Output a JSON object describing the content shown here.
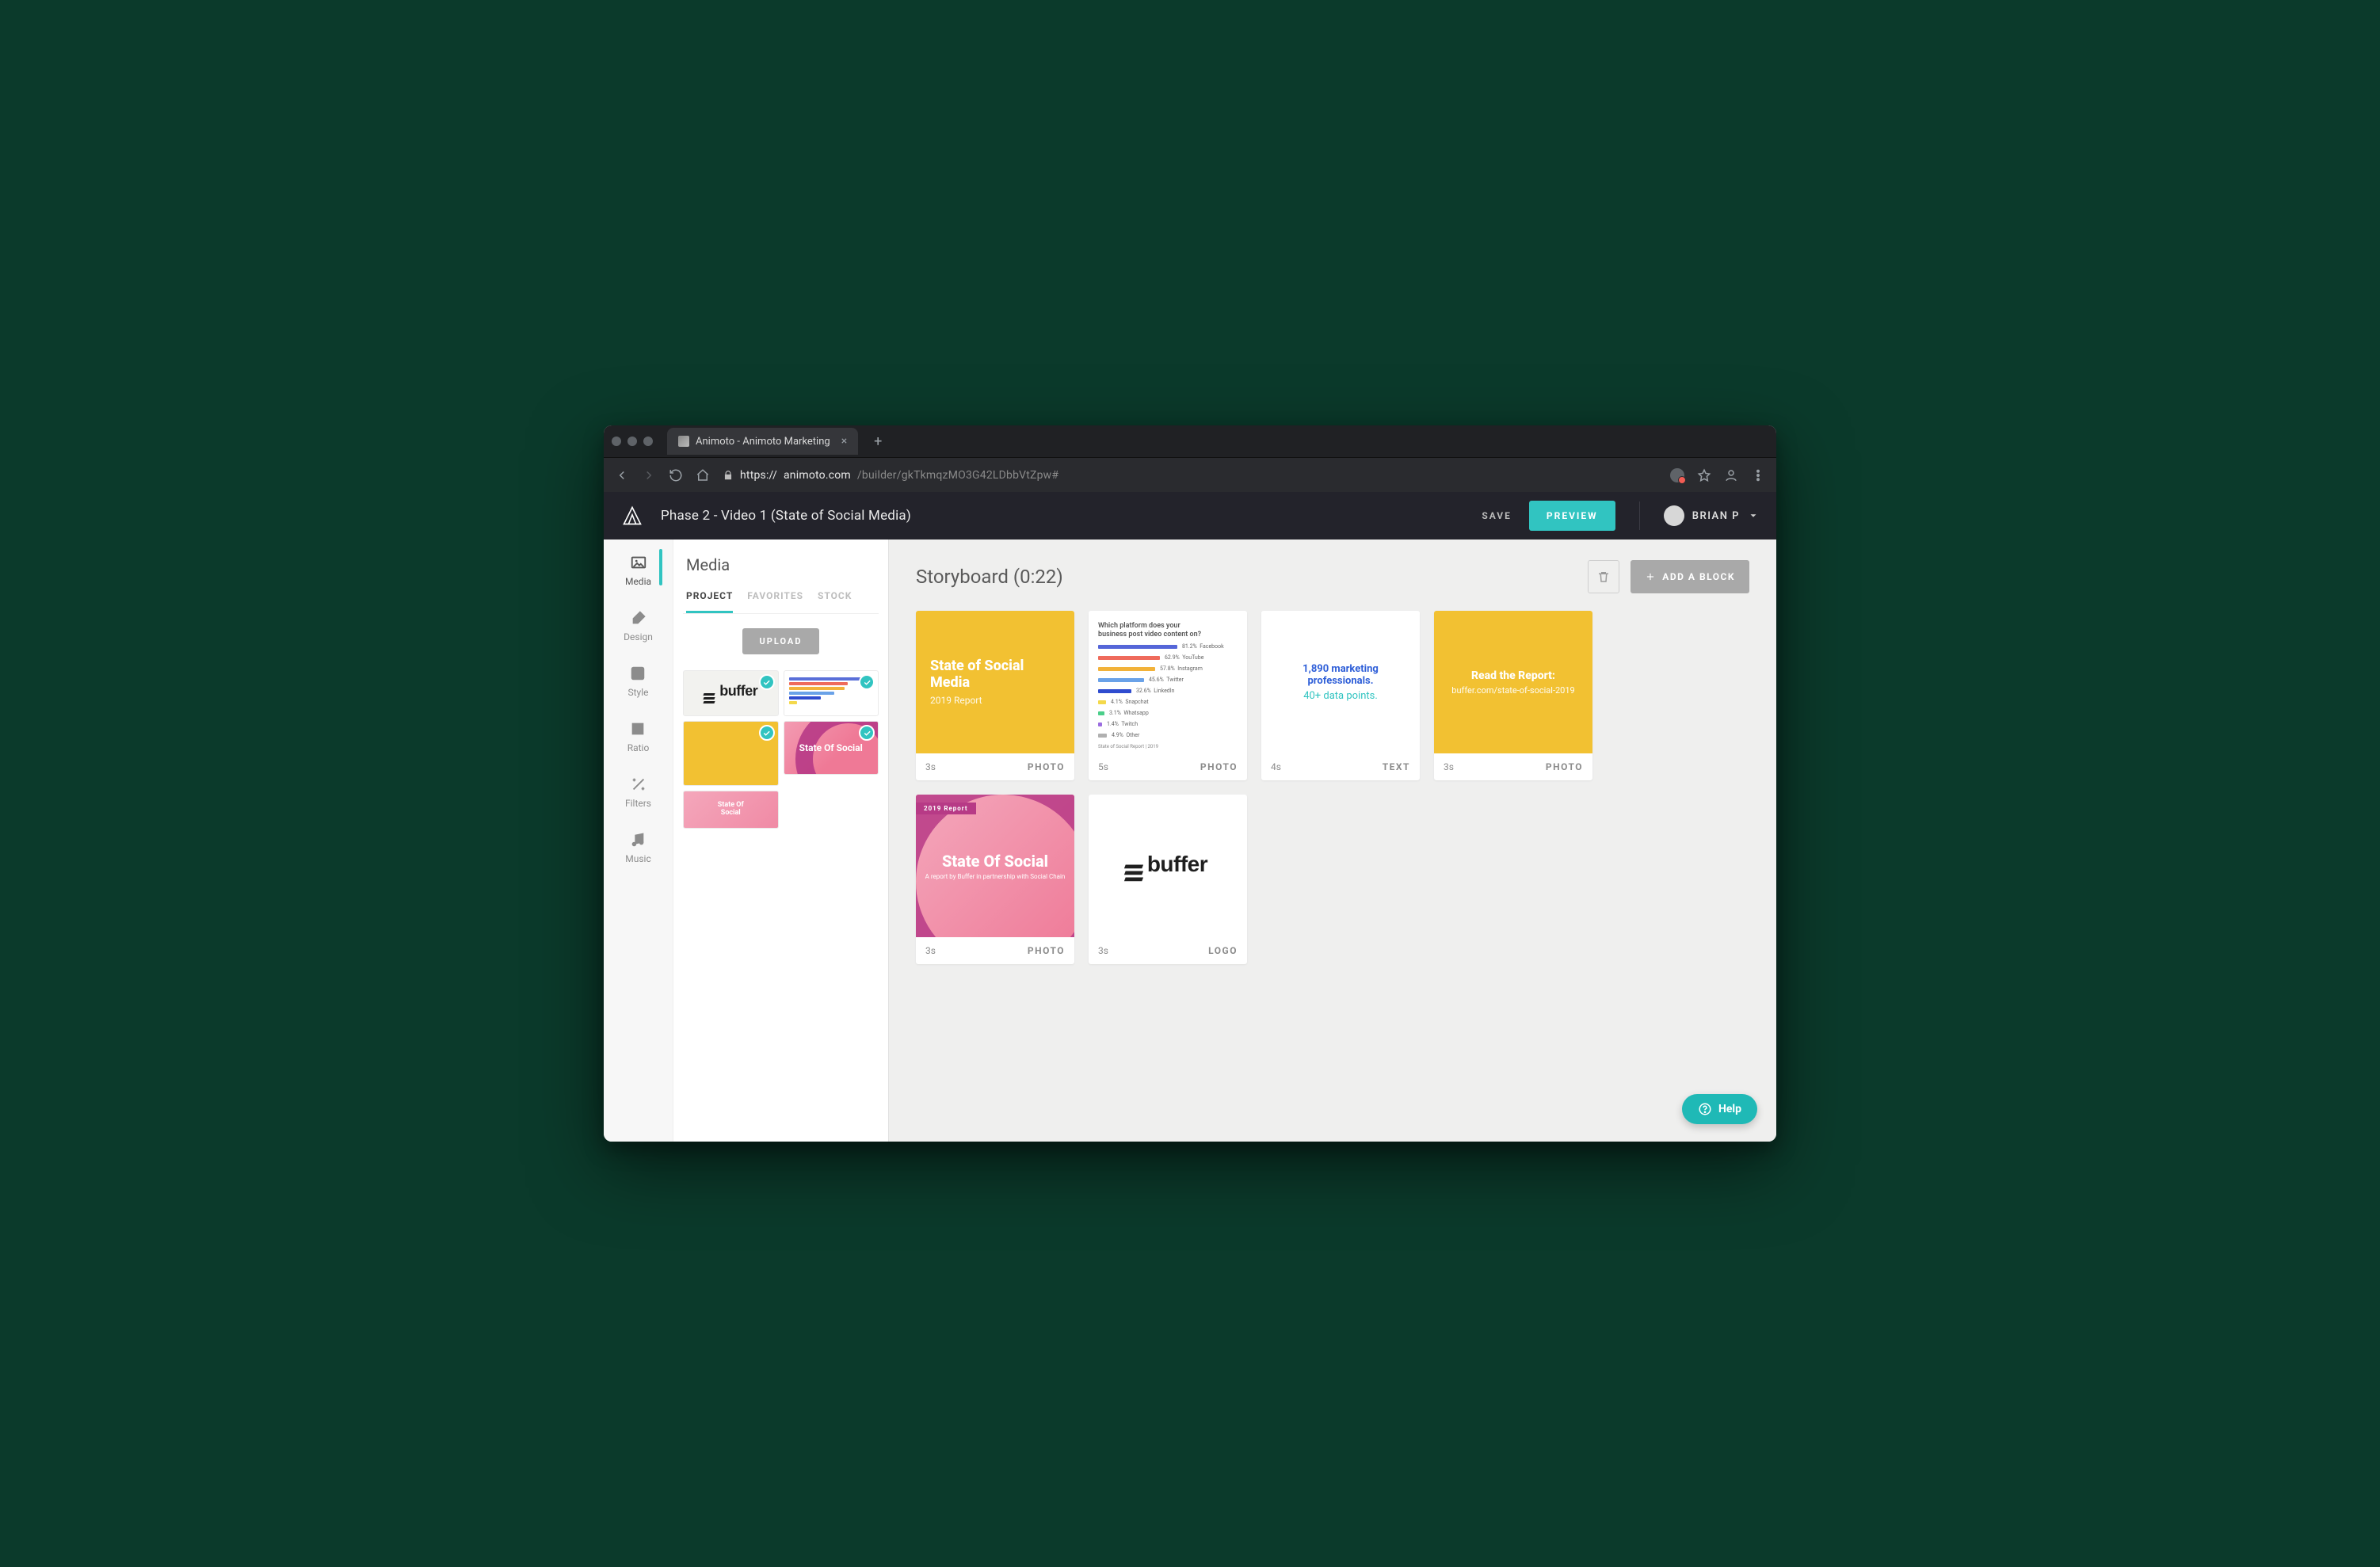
{
  "browser": {
    "tab_title": "Animoto - Animoto Marketing",
    "url_scheme": "https://",
    "url_host": "animoto.com",
    "url_path": "/builder/gkTkmqzMO3G42LDbbVtZpw#"
  },
  "header": {
    "project_title": "Phase 2 - Video 1 (State of Social Media)",
    "save": "SAVE",
    "preview": "PREVIEW",
    "user_name": "BRIAN P"
  },
  "rail": {
    "media": "Media",
    "design": "Design",
    "style": "Style",
    "ratio": "Ratio",
    "filters": "Filters",
    "music": "Music"
  },
  "media_panel": {
    "title": "Media",
    "tab_project": "PROJECT",
    "tab_favorites": "FAVORITES",
    "tab_stock": "STOCK",
    "upload": "UPLOAD",
    "buffer_word": "buffer",
    "pink_label": "State Of Social",
    "pink2_line1": "State Of",
    "pink2_line2": "Social"
  },
  "storyboard": {
    "title": "Storyboard (0:22)",
    "add_block": "ADD A BLOCK",
    "blocks": [
      {
        "duration": "3s",
        "type": "PHOTO",
        "vis": "title_card",
        "title": "State of Social Media",
        "sub": "2019 Report"
      },
      {
        "duration": "5s",
        "type": "PHOTO",
        "vis": "chart",
        "question": "Which platform does your business post video content on?",
        "src": "State of Social Report | 2019",
        "bars": [
          {
            "pct": "81.2%",
            "label": "Facebook",
            "w": 100,
            "c": "#5566d8"
          },
          {
            "pct": "62.9%",
            "label": "YouTube",
            "w": 78,
            "c": "#ef6b5c"
          },
          {
            "pct": "57.8%",
            "label": "Instagram",
            "w": 72,
            "c": "#f2b23a"
          },
          {
            "pct": "45.6%",
            "label": "Twitter",
            "w": 58,
            "c": "#6aa2e8"
          },
          {
            "pct": "32.6%",
            "label": "LinkedIn",
            "w": 42,
            "c": "#2f4ccf"
          },
          {
            "pct": "4.1%",
            "label": "Snapchat",
            "w": 10,
            "c": "#f4d94b"
          },
          {
            "pct": "3.1%",
            "label": "Whatsapp",
            "w": 8,
            "c": "#4bcf8a"
          },
          {
            "pct": "1.4%",
            "label": "Twitch",
            "w": 5,
            "c": "#9b6de0"
          },
          {
            "pct": "4.9%",
            "label": "Other",
            "w": 11,
            "c": "#b0b0b0"
          }
        ]
      },
      {
        "duration": "4s",
        "type": "TEXT",
        "vis": "text_card",
        "l1": "1,890 marketing professionals.",
        "l2": "40+ data points."
      },
      {
        "duration": "3s",
        "type": "PHOTO",
        "vis": "read_card",
        "l1": "Read the Report:",
        "l2": "buffer.com/state-of-social-2019"
      },
      {
        "duration": "3s",
        "type": "PHOTO",
        "vis": "pink_card",
        "band": "2019 Report",
        "title": "State Of Social",
        "sub": "A report by Buffer in partnership with Social Chain"
      },
      {
        "duration": "3s",
        "type": "LOGO",
        "vis": "logo_card",
        "word": "buffer"
      }
    ]
  },
  "help": {
    "label": "Help"
  }
}
